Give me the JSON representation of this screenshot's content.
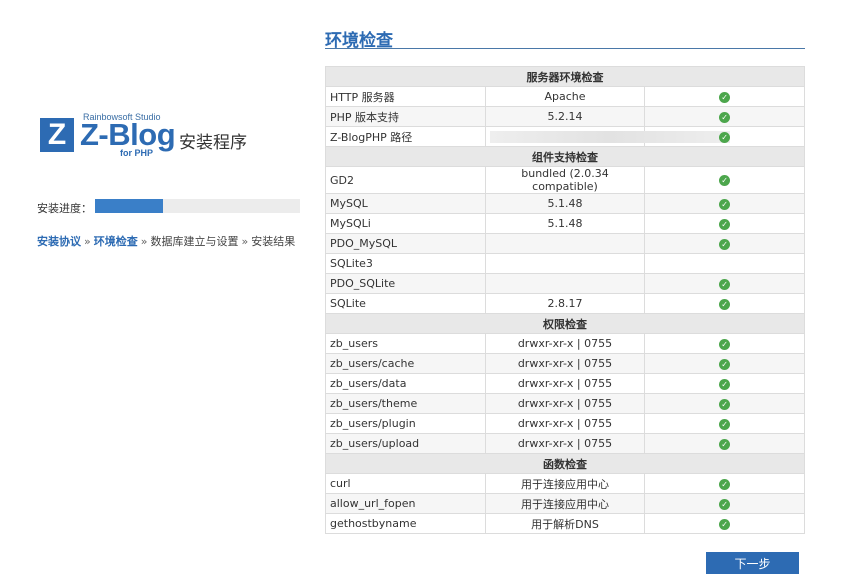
{
  "branding": {
    "studio": "Rainbowsoft Studio",
    "z_letter": "Z",
    "product": "Z-Blog",
    "sub": "for PHP",
    "setup": "安装程序"
  },
  "progress": {
    "label": "安装进度：",
    "fraction": 0.33
  },
  "steps": {
    "items": [
      "安装协议",
      "环境检查",
      "数据库建立与设置",
      "安装结果"
    ],
    "separator": "»",
    "completed_count": 2
  },
  "page": {
    "title": "环境检查"
  },
  "sections": [
    {
      "title": "服务器环境检查",
      "rows": [
        {
          "name": "HTTP 服务器",
          "value": "Apache",
          "ok": true
        },
        {
          "name": "PHP 版本支持",
          "value": "5.2.14",
          "ok": true
        },
        {
          "name": "Z-BlogPHP 路径",
          "value": "",
          "ok": true,
          "redacted": true
        }
      ]
    },
    {
      "title": "组件支持检查",
      "rows": [
        {
          "name": "GD2",
          "value": "bundled (2.0.34 compatible)",
          "ok": true
        },
        {
          "name": "MySQL",
          "value": "5.1.48",
          "ok": true
        },
        {
          "name": "MySQLi",
          "value": "5.1.48",
          "ok": true
        },
        {
          "name": "PDO_MySQL",
          "value": "",
          "ok": true
        },
        {
          "name": "SQLite3",
          "value": "",
          "ok": false
        },
        {
          "name": "PDO_SQLite",
          "value": "",
          "ok": true
        },
        {
          "name": "SQLite",
          "value": "2.8.17",
          "ok": true
        }
      ]
    },
    {
      "title": "权限检查",
      "rows": [
        {
          "name": "zb_users",
          "value": "drwxr-xr-x | 0755",
          "ok": true
        },
        {
          "name": "zb_users/cache",
          "value": "drwxr-xr-x | 0755",
          "ok": true
        },
        {
          "name": "zb_users/data",
          "value": "drwxr-xr-x | 0755",
          "ok": true
        },
        {
          "name": "zb_users/theme",
          "value": "drwxr-xr-x | 0755",
          "ok": true
        },
        {
          "name": "zb_users/plugin",
          "value": "drwxr-xr-x | 0755",
          "ok": true
        },
        {
          "name": "zb_users/upload",
          "value": "drwxr-xr-x | 0755",
          "ok": true
        }
      ]
    },
    {
      "title": "函数检查",
      "rows": [
        {
          "name": "curl",
          "value": "用于连接应用中心",
          "ok": true
        },
        {
          "name": "allow_url_fopen",
          "value": "用于连接应用中心",
          "ok": true
        },
        {
          "name": "gethostbyname",
          "value": "用于解析DNS",
          "ok": true
        }
      ]
    }
  ],
  "status_icon": "check-circle-icon",
  "colors": {
    "accent": "#2d6bb3",
    "ok": "#4ca64c",
    "section_bg": "#e8e8e8"
  },
  "next_button": {
    "label": "下一步"
  }
}
